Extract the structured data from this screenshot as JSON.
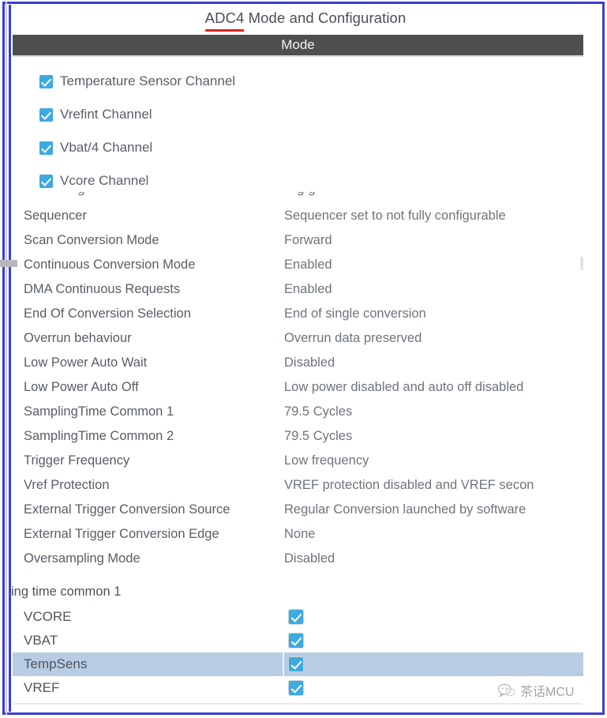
{
  "window": {
    "title_prefix": "ADC4",
    "title_rest": " Mode and Configuration",
    "frame_color": "#3b3fd0",
    "accent_red": "#e8211a"
  },
  "section_header": {
    "label": "Mode",
    "bg_color": "#4f4f4f",
    "text_color": "#f2f2f2"
  },
  "checkbox_options": [
    {
      "label": "Temperature Sensor Channel",
      "checked": true
    },
    {
      "label": "Vrefint Channel",
      "checked": true
    },
    {
      "label": "Vbat/4 Channel",
      "checked": true
    },
    {
      "label": "Vcore Channel",
      "checked": true
    }
  ],
  "checkbox_color": "#3daae0",
  "clipped_top_row": {
    "name_fragment": "g",
    "value_fragment": "g g"
  },
  "parameters": [
    {
      "name": "Sequencer",
      "value": "Sequencer set to not fully configurable"
    },
    {
      "name": "Scan Conversion Mode",
      "value": "Forward"
    },
    {
      "name": "Continuous Conversion Mode",
      "value": "Enabled"
    },
    {
      "name": "DMA Continuous Requests",
      "value": "Enabled"
    },
    {
      "name": "End Of Conversion Selection",
      "value": "End of single conversion"
    },
    {
      "name": "Overrun behaviour",
      "value": "Overrun data preserved"
    },
    {
      "name": "Low Power Auto Wait",
      "value": "Disabled"
    },
    {
      "name": "Low Power Auto Off",
      "value": "Low power disabled and auto off disabled"
    },
    {
      "name": "SamplingTime Common 1",
      "value": "79.5 Cycles"
    },
    {
      "name": "SamplingTime Common 2",
      "value": "79.5 Cycles"
    },
    {
      "name": "Trigger Frequency",
      "value": "Low frequency"
    },
    {
      "name": "Vref Protection",
      "value": "VREF protection disabled and VREF secon"
    },
    {
      "name": "External Trigger Conversion Source",
      "value": "Regular Conversion launched by software"
    },
    {
      "name": "External Trigger Conversion Edge",
      "value": "None"
    },
    {
      "name": "Oversampling Mode",
      "value": "Disabled"
    }
  ],
  "partial_group_label": "ing time common 1",
  "channel_table": {
    "rows": [
      {
        "name": "VCORE",
        "checked": true,
        "selected": false
      },
      {
        "name": "VBAT",
        "checked": true,
        "selected": false
      },
      {
        "name": "TempSens",
        "checked": true,
        "selected": true
      },
      {
        "name": "VREF",
        "checked": true,
        "selected": false
      }
    ],
    "selected_row_color": "#b8cce4"
  },
  "watermark": {
    "text": "茶话MCU",
    "icon": "chat-bubble-icon"
  }
}
